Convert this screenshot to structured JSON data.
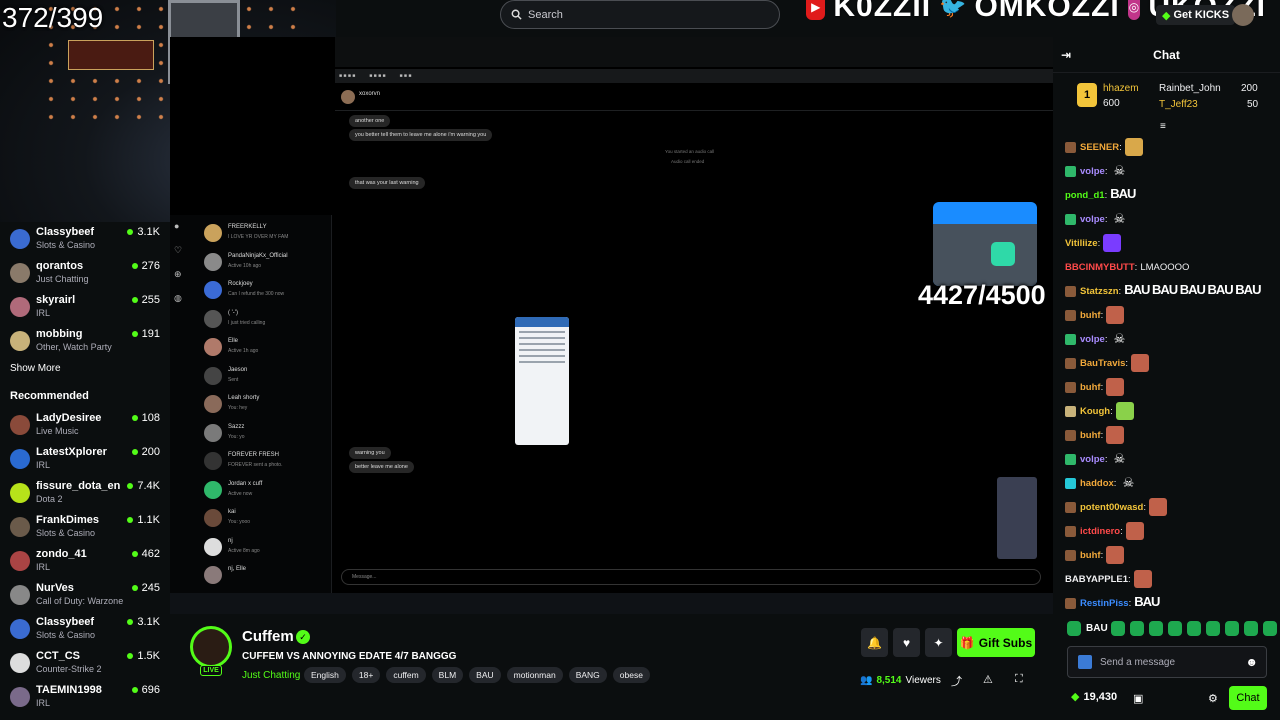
{
  "overlay": {
    "top_counter": "372/399",
    "mid_counter": "4427/4500",
    "social_1": "K0ZZII",
    "social_2": "OMKOZZI",
    "social_3": "UKOZZI"
  },
  "header": {
    "search_placeholder": "Search",
    "get_kicks": "Get KICKS"
  },
  "sidebar": {
    "following": [
      {
        "name": "Classybeef",
        "category": "Slots & Casino",
        "viewers": "3.1K",
        "color": "#3a6bd1"
      },
      {
        "name": "qorantos",
        "category": "Just Chatting",
        "viewers": "276",
        "color": "#8a7a6a"
      },
      {
        "name": "skyrairl",
        "category": "IRL",
        "viewers": "255",
        "color": "#b06a7a"
      },
      {
        "name": "mobbing",
        "category": "Other, Watch Party",
        "viewers": "191",
        "color": "#c8b27a"
      }
    ],
    "show_more": "Show More",
    "recommended_heading": "Recommended",
    "recommended": [
      {
        "name": "LadyDesiree",
        "category": "Live Music",
        "viewers": "108",
        "color": "#8a4a3a"
      },
      {
        "name": "LatestXplorer",
        "category": "IRL",
        "viewers": "200",
        "color": "#2a6ad1"
      },
      {
        "name": "fissure_dota_en",
        "category": "Dota 2",
        "viewers": "7.4K",
        "color": "#b7e21a"
      },
      {
        "name": "FrankDimes",
        "category": "Slots & Casino",
        "viewers": "1.1K",
        "color": "#6a5a4a"
      },
      {
        "name": "zondo_41",
        "category": "IRL",
        "viewers": "462",
        "color": "#a44"
      },
      {
        "name": "NurVes",
        "category": "Call of Duty: Warzone",
        "viewers": "245",
        "color": "#888"
      },
      {
        "name": "Classybeef",
        "category": "Slots & Casino",
        "viewers": "3.1K",
        "color": "#3a6bd1"
      },
      {
        "name": "CCT_CS",
        "category": "Counter-Strike 2",
        "viewers": "1.5K",
        "color": "#ddd"
      },
      {
        "name": "TAEMIN1998",
        "category": "IRL",
        "viewers": "696",
        "color": "#7a6a8a"
      }
    ]
  },
  "screen": {
    "dm_user": "xoxorvn",
    "messages": [
      "another one",
      "you better tell them to leave me alone i'm warning you",
      "that was your last warning",
      "warning you",
      "better leave me alone"
    ],
    "system_1": "You started an audio call",
    "system_2": "Audio call ended",
    "message_placeholder": "Message...",
    "dm_list": [
      {
        "name": "FREERKELLY",
        "sub": "I LOVE YR OVER MY FAM"
      },
      {
        "name": "PandaNinjaKx_Official",
        "sub": "Active 10h ago"
      },
      {
        "name": "Rockjoey",
        "sub": "Can I refund the 300 now"
      },
      {
        "name": "( '-')",
        "sub": "I just tried calling"
      },
      {
        "name": "Elle",
        "sub": "Active 1h ago"
      },
      {
        "name": "Jaeson",
        "sub": "Sent"
      },
      {
        "name": "Leah shorty",
        "sub": "You: hey"
      },
      {
        "name": "Sazzz",
        "sub": "You: yo"
      },
      {
        "name": "FOREVER FRESH",
        "sub": "FOREVER sent a photo."
      },
      {
        "name": "Jordan x cuff",
        "sub": "Active now"
      },
      {
        "name": "kai",
        "sub": "You: yooo"
      },
      {
        "name": "nj",
        "sub": "Active 8m ago"
      },
      {
        "name": "nj, Elle",
        "sub": ""
      }
    ]
  },
  "stream_info": {
    "streamer": "Cuffem",
    "live": "LIVE",
    "title": "CUFFEM VS ANNOYING EDATE 4/7 BANGGG",
    "category": "Just Chatting",
    "tags": [
      "English",
      "18+",
      "cuffem",
      "BLM",
      "BAU",
      "motionman",
      "BANG",
      "obese"
    ],
    "gift_subs": "Gift Subs",
    "viewer_count": "8,514",
    "viewers_label": "Viewers"
  },
  "chat": {
    "title": "Chat",
    "leaderboard": [
      {
        "name": "hhazem",
        "value": "600"
      },
      {
        "name": "Rainbet_John",
        "value": "200"
      },
      {
        "name": "T_Jeff23",
        "value": "50"
      }
    ],
    "messages": [
      {
        "user": "SEENER",
        "color": "#f2a93b",
        "text": "",
        "emote": "e1",
        "badge": "#8a5a3a"
      },
      {
        "user": "volpe",
        "color": "#a98cff",
        "text": "",
        "emote": "e2",
        "badge": "#2fb86a"
      },
      {
        "user": "pond_d1",
        "color": "#53fc18",
        "text": "",
        "emote": "BAU",
        "badge": ""
      },
      {
        "user": "volpe",
        "color": "#a98cff",
        "text": "",
        "emote": "e2",
        "badge": "#2fb86a"
      },
      {
        "user": "Vitiliize",
        "color": "#f2c43a",
        "text": "",
        "emote": "e3",
        "badge": ""
      },
      {
        "user": "BBCINMYBUTT",
        "color": "#ff4a4a",
        "text": "LMAOOOO",
        "emote": "",
        "badge": ""
      },
      {
        "user": "Statzszn",
        "color": "#f2c43a",
        "text": "",
        "emote": "BAU BAU BAU BAU BAU",
        "badge": "#8a5a3a"
      },
      {
        "user": "buhf",
        "color": "#f2a93b",
        "text": "",
        "emote": "e4",
        "badge": "#8a5a3a"
      },
      {
        "user": "volpe",
        "color": "#a98cff",
        "text": "",
        "emote": "e2",
        "badge": "#2fb86a"
      },
      {
        "user": "BauTravis",
        "color": "#f2a93b",
        "text": "",
        "emote": "e4",
        "badge": "#8a5a3a"
      },
      {
        "user": "buhf",
        "color": "#f2a93b",
        "text": "",
        "emote": "e4",
        "badge": "#8a5a3a"
      },
      {
        "user": "Kough",
        "color": "#f2c43a",
        "text": "",
        "emote": "e5",
        "badge": "#c8b27a"
      },
      {
        "user": "buhf",
        "color": "#f2a93b",
        "text": "",
        "emote": "e4",
        "badge": "#8a5a3a"
      },
      {
        "user": "volpe",
        "color": "#a98cff",
        "text": "",
        "emote": "e2",
        "badge": "#2fb86a"
      },
      {
        "user": "haddox",
        "color": "#f2a93b",
        "text": "",
        "emote": "e2",
        "badge": "#25c8d8"
      },
      {
        "user": "potent00wasd",
        "color": "#f2c43a",
        "text": "",
        "emote": "e4",
        "badge": "#8a5a3a"
      },
      {
        "user": "ictdinero",
        "color": "#ff4a4a",
        "text": "",
        "emote": "e4",
        "badge": "#8a5a3a"
      },
      {
        "user": "buhf",
        "color": "#f2a93b",
        "text": "",
        "emote": "e4",
        "badge": "#8a5a3a"
      },
      {
        "user": "BABYAPPLE1",
        "color": "#efeff1",
        "text": "",
        "emote": "e4",
        "badge": ""
      },
      {
        "user": "RestinPiss",
        "color": "#3b8cff",
        "text": "",
        "emote": "BAU",
        "badge": "#8a5a3a"
      }
    ],
    "emote_bar": [
      "",
      "BAU",
      "",
      "",
      "",
      "",
      "",
      "",
      "",
      "",
      ""
    ],
    "input_placeholder": "Send a message",
    "kicks_balance": "19,430",
    "send_label": "Chat"
  }
}
